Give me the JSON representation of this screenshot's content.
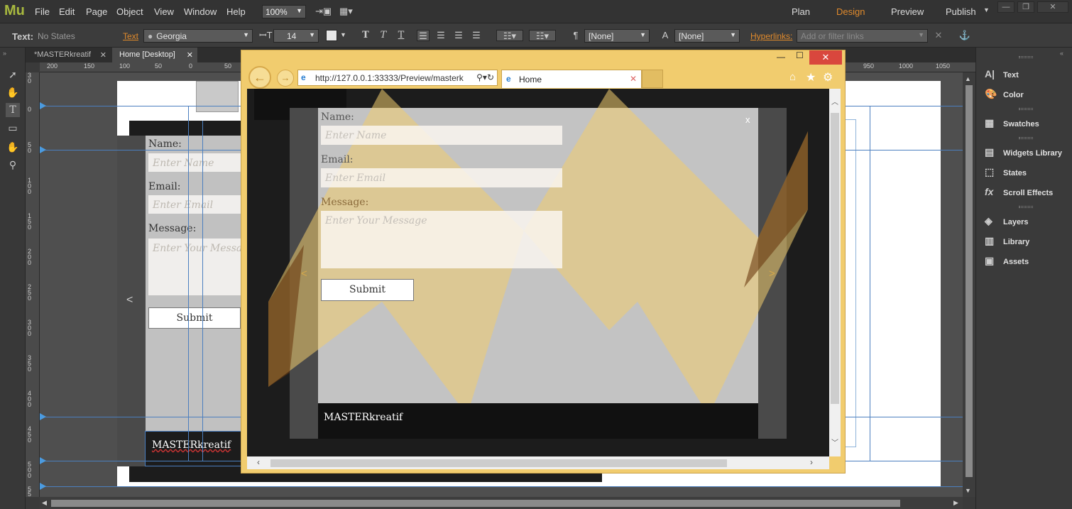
{
  "app": {
    "logo": "Mu",
    "menu": [
      "File",
      "Edit",
      "Page",
      "Object",
      "View",
      "Window",
      "Help"
    ],
    "zoom": "100%",
    "workspace_tabs": [
      "Plan",
      "Design",
      "Preview",
      "Publish"
    ],
    "active_tab": "Design"
  },
  "toolbar": {
    "text_label": "Text:",
    "states": "No States",
    "text_link": "Text",
    "font": "Georgia",
    "font_size": "14",
    "style1": "[None]",
    "style2": "[None]",
    "hyperlinks_label": "Hyperlinks:",
    "hyperlinks_placeholder": "Add or filter links"
  },
  "doc_tabs": [
    "*MASTERkreatif",
    "Home [Desktop]"
  ],
  "ruler_h": [
    "200",
    "150",
    "100",
    "50",
    "0",
    "50",
    "950",
    "1000",
    "1050"
  ],
  "ruler_v": [
    "3\n0",
    "0",
    "5\n0",
    "1\n0\n0",
    "1\n5\n0",
    "2\n0\n0",
    "2\n5\n0",
    "3\n0\n0",
    "3\n5\n0",
    "4\n0\n0",
    "4\n5\n0",
    "5\n0\n0",
    "5\n5"
  ],
  "panels": [
    "Text",
    "Color",
    "Swatches",
    "Widgets Library",
    "States",
    "Scroll Effects",
    "Layers",
    "Library",
    "Assets"
  ],
  "page": {
    "name_label": "Name:",
    "name_placeholder": "Enter Name",
    "email_label": "Email:",
    "email_placeholder": "Enter Email",
    "message_label": "Message:",
    "message_placeholder": "Enter Your Message",
    "submit": "Submit",
    "footer": "MASTERkreatif",
    "prev": "<",
    "next": ">",
    "close": "x"
  },
  "browser": {
    "url": "http://127.0.0.1:33333/Preview/masterk",
    "tab_title": "Home"
  },
  "colors": {
    "accent": "#e08a2c",
    "brand": "#a8b93f",
    "guide": "#4b7fbf",
    "browser_frame": "#f1cc6e",
    "close_button": "#d9473d"
  }
}
